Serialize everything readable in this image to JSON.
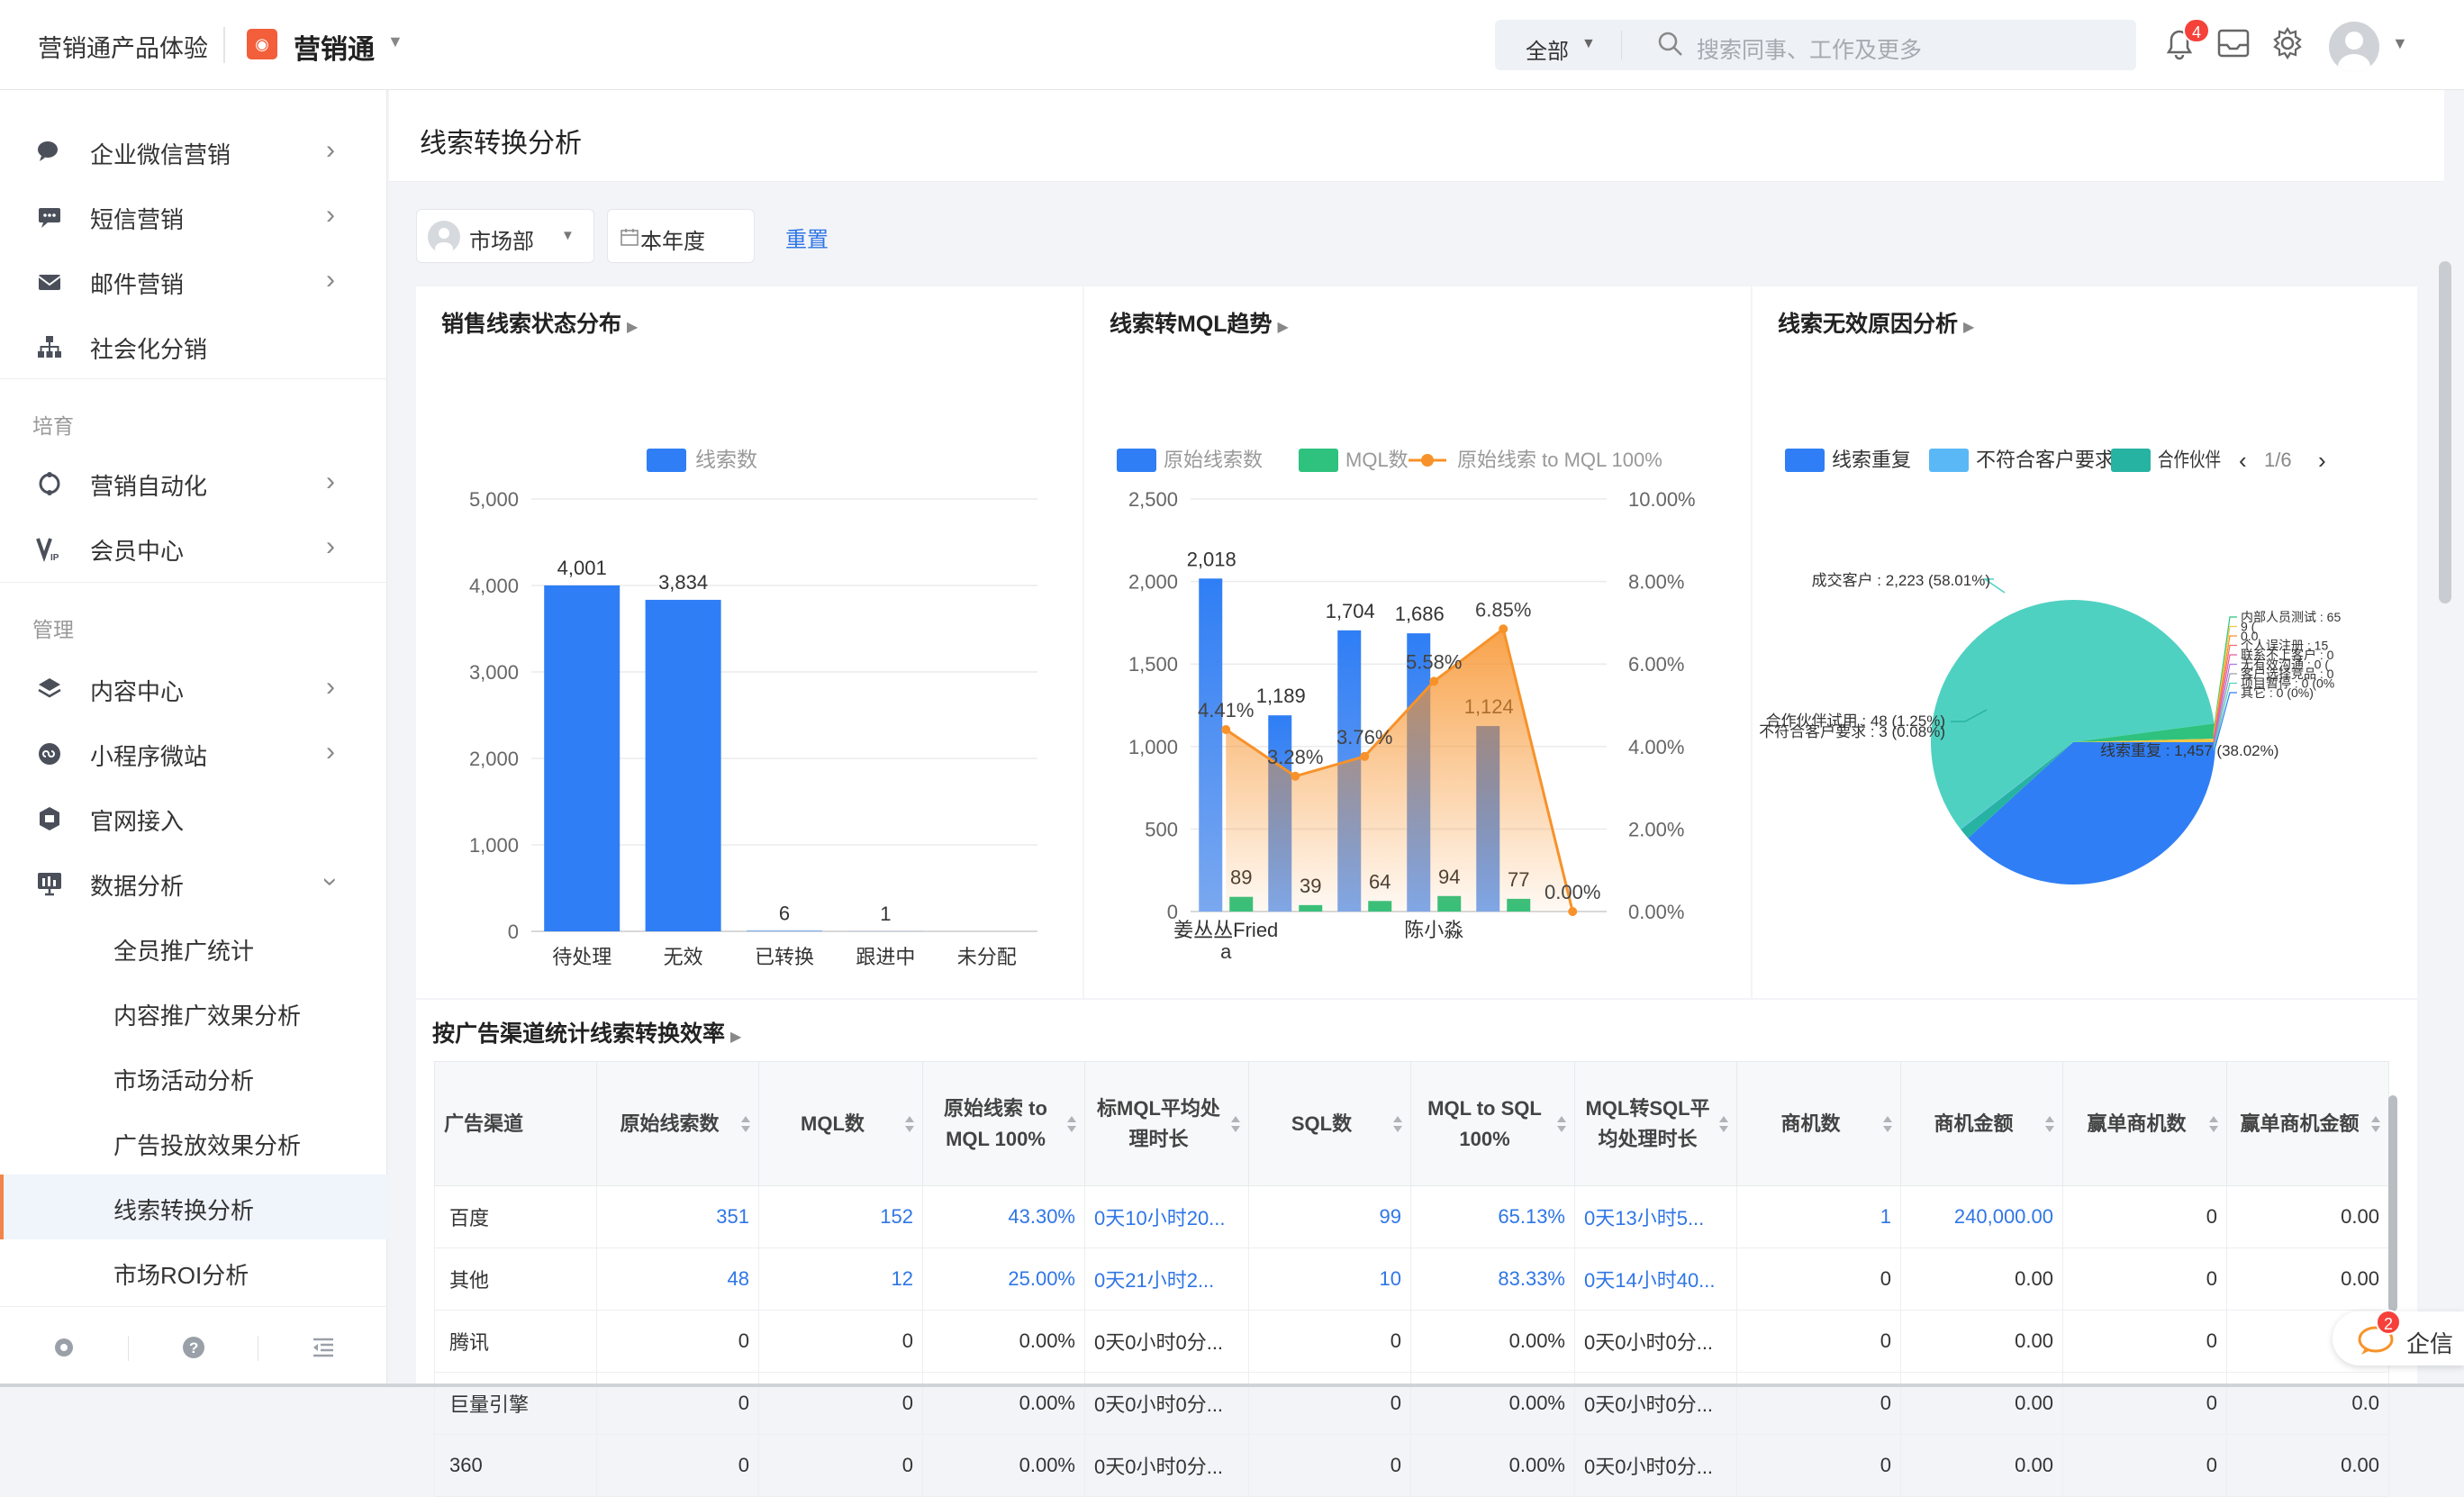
{
  "topbar": {
    "product": "营销通产品体验",
    "app_name": "营销通",
    "search_scope": "全部",
    "search_placeholder": "搜索同事、工作及更多",
    "notif_count": "4"
  },
  "sidebar": {
    "items": [
      {
        "label": "企业微信营销",
        "icon": "wechat-icon"
      },
      {
        "label": "短信营销",
        "icon": "sms-icon"
      },
      {
        "label": "邮件营销",
        "icon": "mail-icon"
      },
      {
        "label": "社会化分销",
        "icon": "org-tree-icon"
      },
      {
        "label": "营销自动化",
        "icon": "automation-icon"
      },
      {
        "label": "会员中心",
        "icon": "vip-icon"
      },
      {
        "label": "内容中心",
        "icon": "layers-icon"
      },
      {
        "label": "小程序微站",
        "icon": "miniprogram-icon"
      },
      {
        "label": "官网接入",
        "icon": "website-icon"
      },
      {
        "label": "数据分析",
        "icon": "analytics-icon"
      }
    ],
    "groups": {
      "nurture": "培育",
      "manage": "管理"
    },
    "sub_items": [
      "全员推广统计",
      "内容推广效果分析",
      "市场活动分析",
      "广告投放效果分析",
      "线索转换分析",
      "市场ROI分析"
    ]
  },
  "page": {
    "title": "线索转换分析",
    "filter_dept": "市场部",
    "filter_period": "本年度",
    "reset": "重置"
  },
  "chart1": {
    "title": "销售线索状态分布",
    "legend": "线索数",
    "color": "#2f7ef5"
  },
  "chart2": {
    "title": "线索转MQL趋势",
    "legend": [
      "原始线索数",
      "MQL数",
      "原始线索 to MQL 100%"
    ],
    "colors": {
      "raw": "#2f7ef5",
      "mql": "#2ec27e",
      "rate": "#f7922a"
    }
  },
  "chart3": {
    "title": "线索无效原因分析",
    "legend": [
      "线索重复",
      "不符合客户要求",
      "合作伙伴"
    ],
    "pager": "1/6",
    "colors": [
      "#2f7ef5",
      "#5ab8f7",
      "#27b3a2",
      "#4fd1c1"
    ]
  },
  "chart_data": [
    {
      "type": "bar",
      "title": "销售线索状态分布",
      "categories": [
        "待处理",
        "无效",
        "已转换",
        "跟进中",
        "未分配"
      ],
      "series": [
        {
          "name": "线索数",
          "values": [
            4001,
            3834,
            6,
            1,
            0
          ]
        }
      ],
      "y_ticks": [
        "5,000",
        "4,000",
        "3,000",
        "2,000",
        "1,000",
        "0"
      ],
      "labels": [
        "4,001",
        "3,834",
        "6",
        "1",
        ""
      ],
      "ylim": [
        0,
        5000
      ]
    },
    {
      "type": "bar",
      "title": "线索转MQL趋势",
      "categories": [
        "姜丛丛Friedа",
        "",
        "",
        "陈小淼",
        "",
        ""
      ],
      "x_labels": [
        "姜丛丛Fried\na",
        "陈小淼"
      ],
      "series": [
        {
          "name": "原始线索数",
          "values": [
            2018,
            1189,
            1704,
            1686,
            1124,
            0
          ]
        },
        {
          "name": "MQL数",
          "values": [
            89,
            39,
            64,
            94,
            77,
            0
          ]
        },
        {
          "name": "原始线索 to MQL 100%",
          "values": [
            4.41,
            3.28,
            3.76,
            5.58,
            6.85,
            0.0
          ]
        }
      ],
      "raw_labels": [
        "2,018",
        "1,189",
        "1,704",
        "1,686",
        "1,124"
      ],
      "mql_labels": [
        "89",
        "39",
        "64",
        "94",
        "77"
      ],
      "rate_labels": [
        "4.41%",
        "3.28%",
        "3.76%",
        "5.58%",
        "6.85%",
        "0.00%"
      ],
      "y_left_ticks": [
        "2,500",
        "2,000",
        "1,500",
        "1,000",
        "500",
        "0"
      ],
      "y_right_ticks": [
        "10.00%",
        "8.00%",
        "6.00%",
        "4.00%",
        "2.00%",
        "0.00%"
      ],
      "ylim": [
        0,
        2500
      ],
      "y2lim": [
        0,
        10
      ]
    },
    {
      "type": "pie",
      "title": "线索无效原因分析",
      "slices": [
        {
          "label": "成交客户 : 2,223 (58.01%)",
          "value": 2223
        },
        {
          "label": "线索重复 : 1,457 (38.02%)",
          "value": 1457
        },
        {
          "label": "合作伙伴试用 : 48 (1.25%)",
          "value": 48
        },
        {
          "label": "不符合客户要求 : 3 (0.08%)",
          "value": 3
        },
        {
          "label": "内部人员测试 : 65",
          "value": 65
        },
        {
          "label": "个人误注册 : 15",
          "value": 15
        },
        {
          "label": "联系不上客户 : 0",
          "value": 0
        },
        {
          "label": "无有效沟通 : 0",
          "value": 0
        },
        {
          "label": "客户选择竞品 : 0",
          "value": 0
        },
        {
          "label": "项目暂停 : 0 (0%)",
          "value": 0
        },
        {
          "label": "其它 : 0 (0%)",
          "value": 0
        }
      ],
      "visible_labels": {
        "left_top": "成交客户 : 2,223 (58.01%)",
        "left_bottom_1": "合作伙伴试用 : 48 (1.25%)",
        "left_bottom_2": "不符合客户要求 : 3 (0.08%)",
        "bottom": "线索重复 : 1,457 (38.02%)",
        "right": [
          "内部人员测试 : 65",
          "9 (",
          "0.0",
          "个人误注册 : 15",
          "联系不上客户 : 0",
          "无有效沟通 : 0 (",
          "客户选择竞品 : 0",
          "项目暂停 : 0 (0%",
          "其它 : 0 (0%)"
        ]
      }
    }
  ],
  "table": {
    "title": "按广告渠道统计线索转换效率",
    "headers": [
      "广告渠道",
      "原始线索数",
      "MQL数",
      "原始线索 to MQL 100%",
      "标MQL平均处理时长",
      "SQL数",
      "MQL to SQL 100%",
      "MQL转SQL平均处理时长",
      "商机数",
      "商机金额",
      "赢单商机数",
      "赢单商机金额"
    ],
    "rows": [
      [
        "百度",
        "351",
        "152",
        "43.30%",
        "0天10小时20...",
        "99",
        "65.13%",
        "0天13小时5...",
        "1",
        "240,000.00",
        "0",
        "0.00"
      ],
      [
        "其他",
        "48",
        "12",
        "25.00%",
        "0天21小时2...",
        "10",
        "83.33%",
        "0天14小时40...",
        "0",
        "0.00",
        "0",
        "0.00"
      ],
      [
        "腾讯",
        "0",
        "0",
        "0.00%",
        "0天0小时0分...",
        "0",
        "0.00%",
        "0天0小时0分...",
        "0",
        "0.00",
        "0",
        "0.00"
      ],
      [
        "巨量引擎",
        "0",
        "0",
        "0.00%",
        "0天0小时0分...",
        "0",
        "0.00%",
        "0天0小时0分...",
        "0",
        "0.00",
        "0",
        "0.0"
      ],
      [
        "360",
        "0",
        "0",
        "0.00%",
        "0天0小时0分...",
        "0",
        "0.00%",
        "0天0小时0分...",
        "0",
        "0.00",
        "0",
        "0.00"
      ]
    ],
    "link_rows": [
      0,
      1
    ]
  },
  "qixin": {
    "label": "企信",
    "count": "2"
  }
}
